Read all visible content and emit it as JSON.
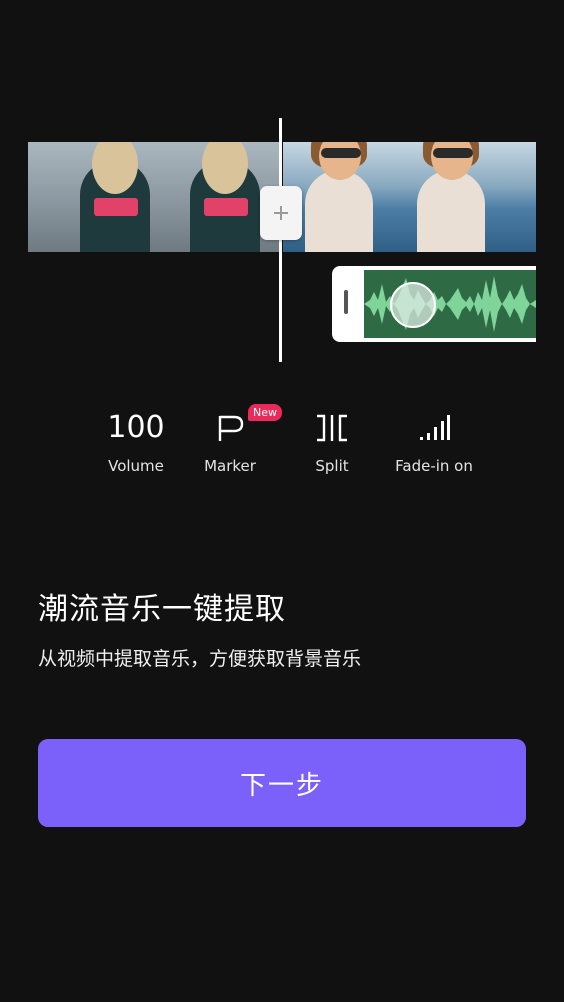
{
  "toolbar": {
    "volume": {
      "value": "100",
      "label": "Volume"
    },
    "marker": {
      "label": "Marker",
      "badge": "New"
    },
    "split": {
      "label": "Split"
    },
    "fade": {
      "label": "Fade-in on"
    }
  },
  "headline": "潮流音乐一键提取",
  "subline": "从视频中提取音乐，方便获取背景音乐",
  "next_button": "下一步",
  "colors": {
    "background": "#111111",
    "accent": "#7b61fa",
    "badge": "#ec2a5a",
    "waveform": "#7fd49a"
  },
  "icons": {
    "add": "plus-icon",
    "marker": "flag-icon",
    "split": "split-icon",
    "fade": "signal-bars-icon"
  }
}
